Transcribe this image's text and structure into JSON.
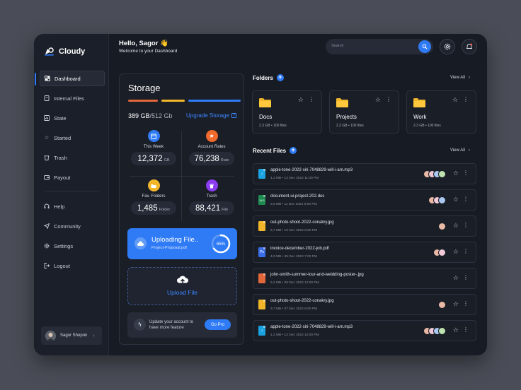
{
  "app": {
    "name": "Cloudy"
  },
  "sidebar": {
    "items": [
      {
        "label": "Dashboard",
        "icon": "dashboard-icon",
        "active": true
      },
      {
        "label": "Internal Files",
        "icon": "files-icon"
      },
      {
        "label": "State",
        "icon": "state-icon"
      },
      {
        "label": "Started",
        "icon": "star-icon"
      },
      {
        "label": "Trash",
        "icon": "trash-icon"
      },
      {
        "label": "Payout",
        "icon": "payout-icon"
      }
    ],
    "secondary": [
      {
        "label": "Help",
        "icon": "help-icon"
      },
      {
        "label": "Community",
        "icon": "community-icon"
      },
      {
        "label": "Settings",
        "icon": "settings-icon"
      },
      {
        "label": "Logout",
        "icon": "logout-icon"
      }
    ],
    "user": {
      "name": "Sagor Shopon"
    }
  },
  "header": {
    "greeting": "Hello, Sagor 👋",
    "subtitle": "Welcome to your Dashboard",
    "search_placeholder": "Search"
  },
  "storage": {
    "title": "Storage",
    "used": "389 GB",
    "total": "/512 Gb",
    "upgrade_label": "Upgrade Storage",
    "bar_colors": [
      "#e2673a",
      "#f2b62b",
      "#2f7bf5"
    ],
    "stats": [
      {
        "label": "This Week",
        "value": "12,372",
        "unit": "GB",
        "color": "#2f7bf5",
        "icon": "calendar-icon"
      },
      {
        "label": "Account Rates",
        "value": "76,238",
        "unit": "Rate",
        "color": "#f26a2b",
        "icon": "star-icon"
      },
      {
        "label": "Fav. Folders",
        "value": "1,485",
        "unit": "Folder",
        "color": "#f2b62b",
        "icon": "folder-icon"
      },
      {
        "label": "Trash",
        "value": "88,421",
        "unit": "File",
        "color": "#8b3cf0",
        "icon": "trash-icon"
      }
    ],
    "uploading": {
      "title": "Uploading File..",
      "file": "Project-Proposal.pdf",
      "percent": 65,
      "percent_label": "65%"
    },
    "upload_label": "Upload File",
    "pro": {
      "text": "Update your account to have more feature",
      "button": "Go Pro"
    }
  },
  "folders": {
    "title": "Folders",
    "view_all": "View All",
    "items": [
      {
        "name": "Docs",
        "size": "2.3 GB",
        "files": "100 files"
      },
      {
        "name": "Projects",
        "size": "2.3 GB",
        "files": "100 files"
      },
      {
        "name": "Work",
        "size": "2.3 GB",
        "files": "100 files"
      }
    ]
  },
  "recent": {
    "title": "Recent Files",
    "view_all": "View All",
    "files": [
      {
        "name": "apple-tone-2022-siri-7048829-will-i-am.mp3",
        "meta": "1,2 MB  •  12 Dec 2022 11:00 PM",
        "type_color": "#1aa3e0",
        "glyph": "♪",
        "avatars": 4
      },
      {
        "name": "document-ui-project-202.dos",
        "meta": "2,5 MB  •  11 Dec 2022 9:00 PM",
        "type_color": "#1e8a4f",
        "glyph": "XLS",
        "avatars": 3
      },
      {
        "name": "out-photo-shoot-2022-conakry.jpg",
        "meta": "3,7 MB  •  10 Dec 2022 8:00 PM",
        "type_color": "#f2b62b",
        "glyph": "",
        "avatars": 1
      },
      {
        "name": "invoice-december-2022-job.pdf",
        "meta": "4,9 MB  •  09 Dec 2022 7:00 PM",
        "type_color": "#3a6ee8",
        "glyph": "Ps",
        "avatars": 2
      },
      {
        "name": "john-smith-summer-tour-and-weidding-poster-.jpg",
        "meta": "6,2 MB  •  08 Dec 2022 12:00 PM",
        "type_color": "#e2673a",
        "glyph": "",
        "avatars": 0
      },
      {
        "name": "out-photo-shoot-2022-conakry.jpg",
        "meta": "3,7 MB  •  07 Dec 2022 8:00 PM",
        "type_color": "#f2b62b",
        "glyph": "",
        "avatars": 1
      },
      {
        "name": "apple-tone-2022-siri-7048829-will-i-am.mp3",
        "meta": "1,2 MB  •  12 Dec 2022 10:00 PM",
        "type_color": "#1aa3e0",
        "glyph": "♪",
        "avatars": 4
      }
    ],
    "avatar_colors": [
      "#e9b9a6",
      "#f0c9d6",
      "#a9c7f0",
      "#bfe3b0"
    ]
  }
}
